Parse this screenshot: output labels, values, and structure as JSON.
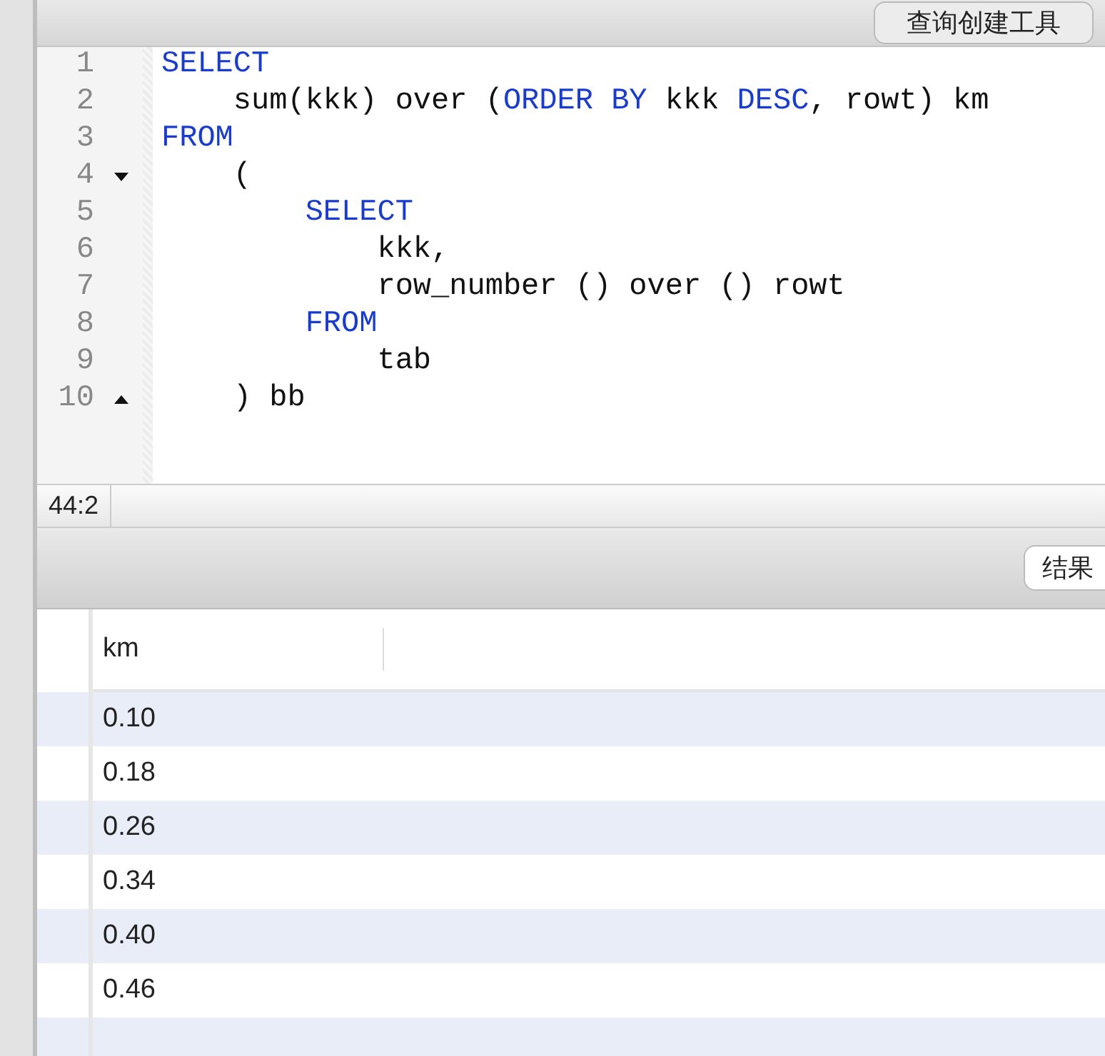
{
  "toolbar": {
    "button": "查询创建工具"
  },
  "editor": {
    "lines": [
      {
        "number": "1",
        "fold_start": false,
        "fold_end": false,
        "tokens": [
          {
            "text": "SELECT",
            "kind": "keyword"
          }
        ]
      },
      {
        "number": "2",
        "fold_start": false,
        "fold_end": false,
        "tokens": [
          {
            "text": "    sum(kkk) over (",
            "kind": "plain"
          },
          {
            "text": "ORDER BY",
            "kind": "keyword"
          },
          {
            "text": " kkk ",
            "kind": "plain"
          },
          {
            "text": "DESC",
            "kind": "keyword"
          },
          {
            "text": ", rowt) km",
            "kind": "plain"
          }
        ]
      },
      {
        "number": "3",
        "fold_start": false,
        "fold_end": false,
        "tokens": [
          {
            "text": "FROM",
            "kind": "keyword"
          }
        ]
      },
      {
        "number": "4",
        "fold_start": true,
        "fold_end": false,
        "tokens": [
          {
            "text": "    (",
            "kind": "plain"
          }
        ]
      },
      {
        "number": "5",
        "fold_start": false,
        "fold_end": false,
        "tokens": [
          {
            "text": "        SELECT",
            "kind": "keyword"
          }
        ]
      },
      {
        "number": "6",
        "fold_start": false,
        "fold_end": false,
        "tokens": [
          {
            "text": "            kkk,",
            "kind": "plain"
          }
        ]
      },
      {
        "number": "7",
        "fold_start": false,
        "fold_end": false,
        "tokens": [
          {
            "text": "            row_number () over () rowt",
            "kind": "plain"
          }
        ]
      },
      {
        "number": "8",
        "fold_start": false,
        "fold_end": false,
        "tokens": [
          {
            "text": "        FROM",
            "kind": "keyword"
          }
        ]
      },
      {
        "number": "9",
        "fold_start": false,
        "fold_end": false,
        "tokens": [
          {
            "text": "            tab",
            "kind": "plain"
          }
        ]
      },
      {
        "number": "10",
        "fold_start": false,
        "fold_end": true,
        "tokens": [
          {
            "text": "    ) bb",
            "kind": "plain"
          }
        ]
      }
    ]
  },
  "status_bar": {
    "cursor": "44:2"
  },
  "results_toolbar": {
    "button": "结果"
  },
  "table": {
    "columns": [
      "km"
    ],
    "rows": [
      [
        "0.10"
      ],
      [
        "0.18"
      ],
      [
        "0.26"
      ],
      [
        "0.34"
      ],
      [
        "0.40"
      ],
      [
        "0.46"
      ]
    ]
  }
}
